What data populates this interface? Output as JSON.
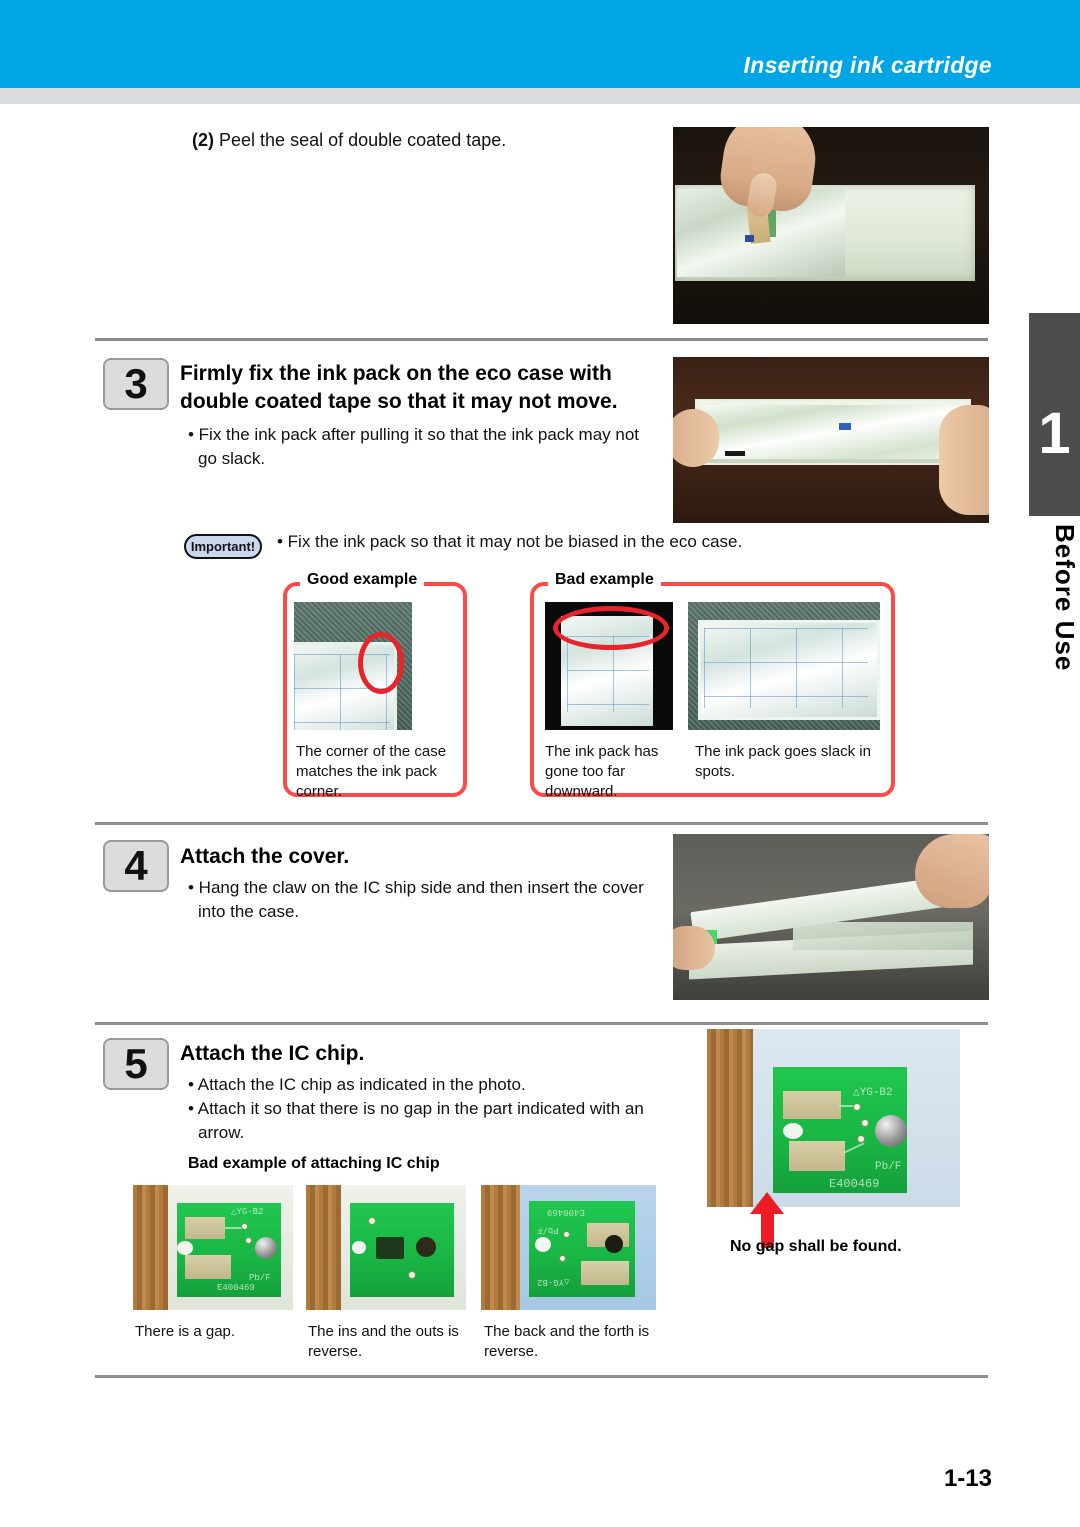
{
  "header": {
    "title": "Inserting ink cartridge",
    "bar_color": "#00a5e5",
    "strip_color": "#dcdddf"
  },
  "side_tab": {
    "number": "1",
    "label": "Before Use",
    "bg_color": "#4d4d4d"
  },
  "step2": {
    "marker": "(2)",
    "text": "Peel the seal of double coated tape.",
    "photo_alt": "Hand peeling the seal of double coated tape from the ink pack in the eco case"
  },
  "step3": {
    "number": "3",
    "title_line1": "Firmly fix the ink pack on the eco case with",
    "title_line2": "double coated tape so that it may not move.",
    "bullet_line1": "• Fix the ink pack after pulling it so that the ink pack may not",
    "bullet_line2": "go slack.",
    "photo_alt": "Two hands holding the ink pack stretched inside the eco case",
    "important": {
      "badge": "Important!",
      "text": "• Fix the ink pack so that it may not be biased in the eco case."
    },
    "examples": {
      "good": {
        "label": "Good example",
        "caption_line1": "The corner of the case",
        "caption_line2": "matches the ink pack",
        "caption_line3": "corner."
      },
      "bad": {
        "label": "Bad example",
        "items": [
          {
            "caption_line1": "The ink pack has",
            "caption_line2": "gone too far",
            "caption_line3": "downward."
          },
          {
            "caption_line1": "The ink pack goes slack in",
            "caption_line2": "spots.",
            "caption_line3": ""
          }
        ]
      }
    }
  },
  "step4": {
    "number": "4",
    "title": "Attach the cover.",
    "bullet_line1": "• Hang the claw on the IC ship side and then insert the cover",
    "bullet_line2": "into the case.",
    "photo_alt": "Hands attaching the cover onto the eco case"
  },
  "step5": {
    "number": "5",
    "title": "Attach the IC chip.",
    "bullet1": "• Attach the IC chip as indicated in the photo.",
    "bullet2_line1": "• Attach it so that there is no gap in the part indicated with an",
    "bullet2_line2": "arrow.",
    "bad_heading": "Bad example of attaching IC chip",
    "bad_examples": [
      {
        "caption_line1": "There is a gap.",
        "caption_line2": ""
      },
      {
        "caption_line1": "The ins and the outs is",
        "caption_line2": "reverse."
      },
      {
        "caption_line1": "The back and the forth is",
        "caption_line2": "reverse."
      }
    ],
    "good_photo": {
      "note": "No gap shall be found.",
      "arrow_color": "#ed1c24",
      "chip_markings": [
        "△YG-B2",
        "Pb/F",
        "E400469"
      ]
    }
  },
  "page_number": "1-13"
}
